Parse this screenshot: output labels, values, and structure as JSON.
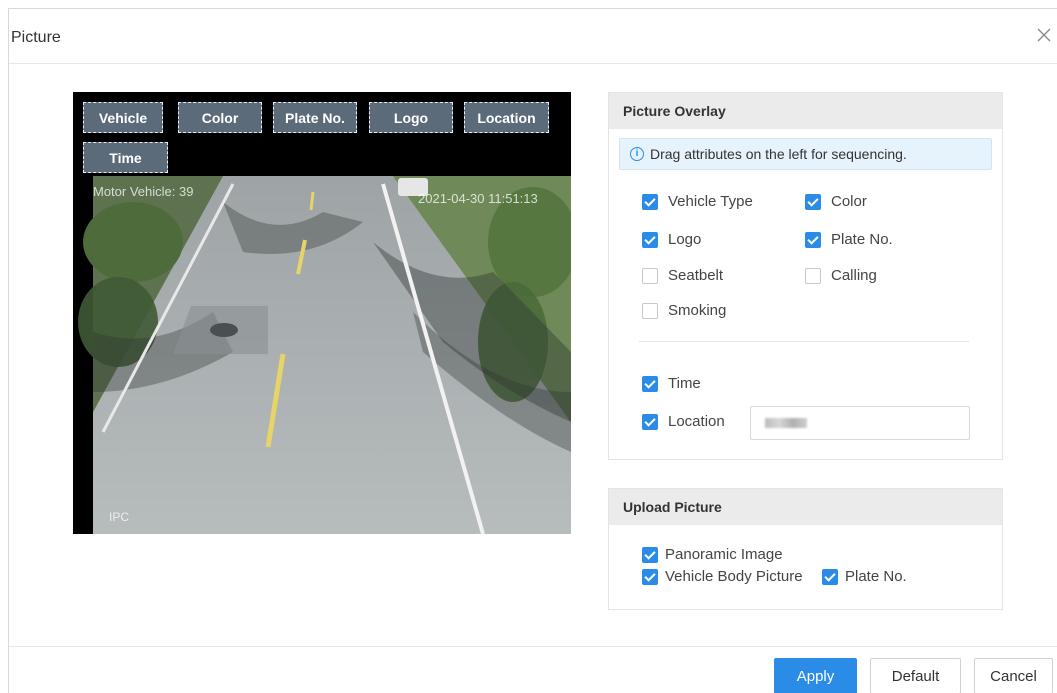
{
  "dialog": {
    "title": "Picture",
    "close_icon": "close-icon"
  },
  "preview": {
    "tags": [
      "Vehicle",
      "Color",
      "Plate No.",
      "Logo",
      "Location",
      "Time"
    ],
    "osd_counter": "Motor Vehicle: 39",
    "osd_time": "2021-04-30 11:51:13",
    "osd_brand": "IPC"
  },
  "picture_overlay": {
    "title": "Picture Overlay",
    "hint": "Drag attributes on the left for sequencing.",
    "hint_icon": "info-icon",
    "options": [
      {
        "label": "Vehicle Type",
        "checked": true
      },
      {
        "label": "Color",
        "checked": true
      },
      {
        "label": "Logo",
        "checked": true
      },
      {
        "label": "Plate No.",
        "checked": true
      },
      {
        "label": "Seatbelt",
        "checked": false
      },
      {
        "label": "Calling",
        "checked": false
      },
      {
        "label": "Smoking",
        "checked": false
      }
    ],
    "time": {
      "label": "Time",
      "checked": true
    },
    "location": {
      "label": "Location",
      "checked": true
    }
  },
  "upload_picture": {
    "title": "Upload Picture",
    "options": [
      {
        "label": "Panoramic Image",
        "checked": true
      },
      {
        "label": "Vehicle Body Picture",
        "checked": true
      },
      {
        "label": "Plate No.",
        "checked": true
      }
    ]
  },
  "footer": {
    "apply": "Apply",
    "default": "Default",
    "cancel": "Cancel"
  },
  "colors": {
    "primary": "#2b8ce8",
    "tag_bg": "#5b6b7a",
    "panel_head": "#ebebeb"
  }
}
